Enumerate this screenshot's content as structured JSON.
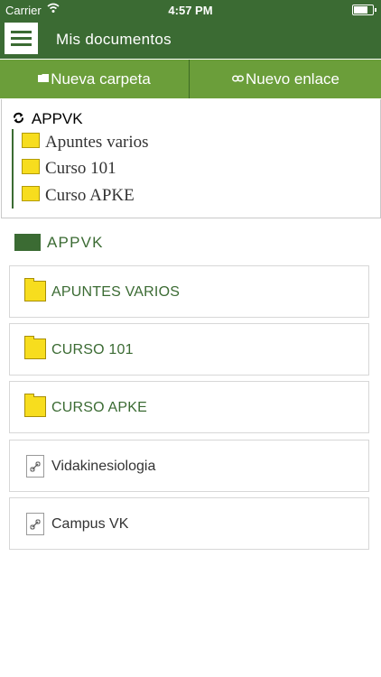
{
  "status": {
    "carrier": "Carrier",
    "time": "4:57 PM"
  },
  "header": {
    "title": "Mis documentos"
  },
  "actions": {
    "new_folder": "Nueva carpeta",
    "new_link": "Nuevo enlace"
  },
  "tree": {
    "root": "APPVK",
    "items": [
      "Apuntes varios",
      "Curso 101",
      "Curso APKE"
    ]
  },
  "section": {
    "title": "APPVK"
  },
  "list": [
    {
      "label": "APUNTES VARIOS",
      "type": "folder"
    },
    {
      "label": "CURSO 101",
      "type": "folder"
    },
    {
      "label": "CURSO APKE",
      "type": "folder"
    },
    {
      "label": "Vidakinesiologia",
      "type": "link"
    },
    {
      "label": "Campus VK",
      "type": "link"
    }
  ],
  "colors": {
    "primary": "#3b6b33",
    "action": "#6b9e3a",
    "folder": "#f7dd1e"
  },
  "icons": [
    "menu-icon",
    "wifi-icon",
    "battery-icon",
    "folder-icon",
    "link-icon",
    "sync-icon",
    "document-link-icon"
  ]
}
